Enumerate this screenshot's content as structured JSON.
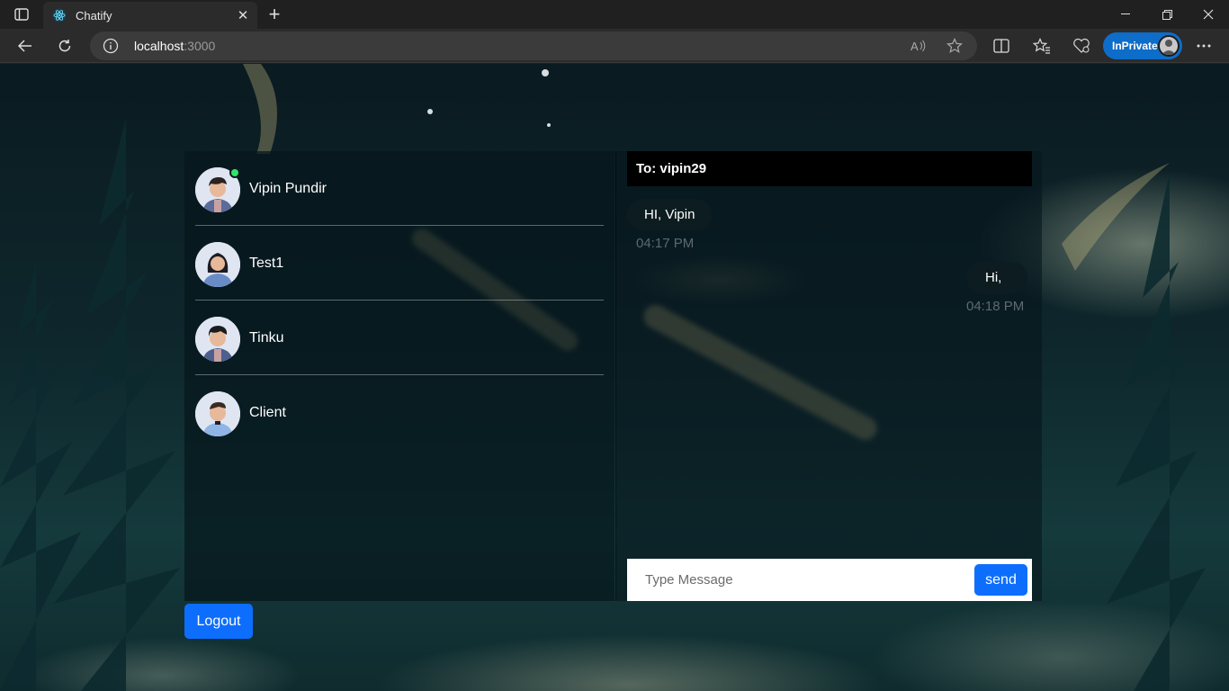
{
  "browser": {
    "tab_title": "Chatify",
    "url_host": "localhost",
    "url_port": ":3000",
    "inprivate_label": "InPrivate"
  },
  "contacts": [
    {
      "name": "Vipin Pundir",
      "online": true
    },
    {
      "name": "Test1",
      "online": false
    },
    {
      "name": "Tinku",
      "online": false
    },
    {
      "name": "Client",
      "online": false
    }
  ],
  "chat": {
    "header": "To: vipin29",
    "messages": [
      {
        "text": "HI, Vipin",
        "time": "04:17 PM",
        "side": "left"
      },
      {
        "text": "Hi,",
        "time": "04:18 PM",
        "side": "right"
      }
    ],
    "input_placeholder": "Type Message",
    "send_label": "send"
  },
  "logout_label": "Logout",
  "colors": {
    "primary_button": "#0d6efd",
    "online_indicator": "#32e36a",
    "inprivate_badge": "#0e6dc9"
  }
}
